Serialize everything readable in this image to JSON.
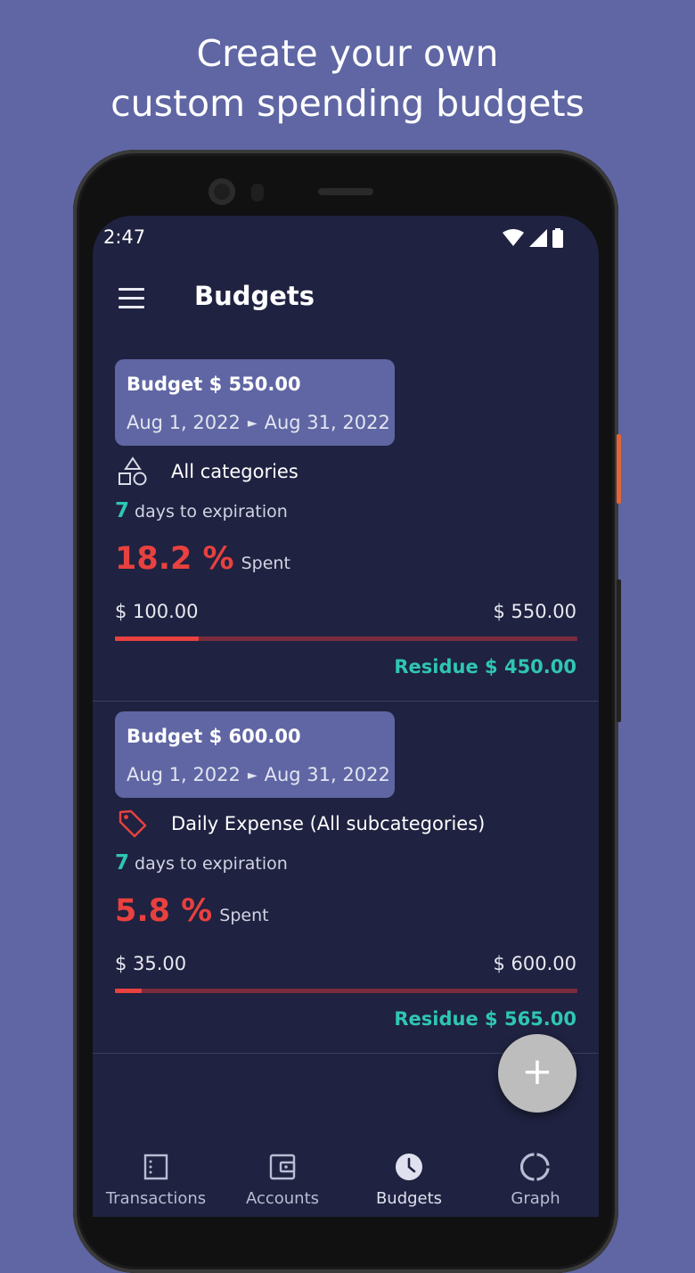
{
  "promo": {
    "line1": "Create your own",
    "line2": "custom spending budgets"
  },
  "status_bar": {
    "time": "2:47",
    "icons": [
      "wifi-icon",
      "cell-signal-icon",
      "battery-icon"
    ]
  },
  "app_bar": {
    "title": "Budgets",
    "menu_icon": "hamburger-menu-icon"
  },
  "budgets": [
    {
      "title": "Budget $ 550.00",
      "start_date": "Aug 1, 2022",
      "end_date": "Aug 31, 2022",
      "category_icon": "shapes-icon",
      "category": "All categories",
      "days_remaining": "7",
      "days_label": "days to expiration",
      "spent_percent": "18.2 %",
      "spent_label": "Spent",
      "spent_amount": "$ 100.00",
      "total_amount": "$ 550.00",
      "residue": "Residue $ 450.00",
      "progress": 0.182
    },
    {
      "title": "Budget $ 600.00",
      "start_date": "Aug 1, 2022",
      "end_date": "Aug 31, 2022",
      "category_icon": "tag-icon",
      "category": "Daily Expense (All subcategories)",
      "days_remaining": "7",
      "days_label": "days to expiration",
      "spent_percent": "5.8 %",
      "spent_label": "Spent",
      "spent_amount": "$ 35.00",
      "total_amount": "$ 600.00",
      "residue": "Residue $ 565.00",
      "progress": 0.058
    }
  ],
  "fab": {
    "icon": "plus-icon",
    "label": "+"
  },
  "bottom_nav": [
    {
      "label": "Transactions",
      "icon": "document-icon",
      "active": false
    },
    {
      "label": "Accounts",
      "icon": "wallet-icon",
      "active": false
    },
    {
      "label": "Budgets",
      "icon": "clock-icon",
      "active": true
    },
    {
      "label": "Graph",
      "icon": "donut-chart-icon",
      "active": false
    }
  ],
  "colors": {
    "background": "#5f66a3",
    "screen": "#1f2240",
    "badge": "#5f66a3",
    "accent_teal": "#2fc6b4",
    "accent_red": "#e8413f",
    "track": "#7a2b3c",
    "fab": "#bdbdbd"
  }
}
